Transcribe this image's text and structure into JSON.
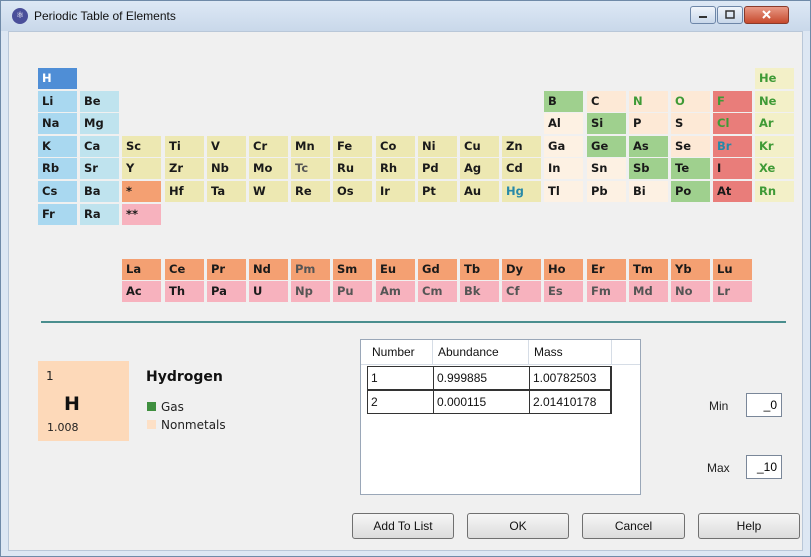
{
  "window": {
    "title": "Periodic Table of Elements",
    "app_icon": "atom-app-icon"
  },
  "elements": [
    {
      "sym": "H",
      "cat": "h",
      "state": "white",
      "r": 0,
      "c": 0
    },
    {
      "sym": "He",
      "cat": "noble",
      "state": "gas",
      "r": 0,
      "c": 17
    },
    {
      "sym": "Li",
      "cat": "alk",
      "state": "solid",
      "r": 1,
      "c": 0
    },
    {
      "sym": "Be",
      "cat": "alke",
      "state": "solid",
      "r": 1,
      "c": 1
    },
    {
      "sym": "B",
      "cat": "metl",
      "state": "solid",
      "r": 1,
      "c": 12
    },
    {
      "sym": "C",
      "cat": "nonm",
      "state": "solid",
      "r": 1,
      "c": 13
    },
    {
      "sym": "N",
      "cat": "nonm",
      "state": "gas",
      "r": 1,
      "c": 14
    },
    {
      "sym": "O",
      "cat": "nonm",
      "state": "gas",
      "r": 1,
      "c": 15
    },
    {
      "sym": "F",
      "cat": "hal",
      "state": "gas",
      "r": 1,
      "c": 16
    },
    {
      "sym": "Ne",
      "cat": "noble",
      "state": "gas",
      "r": 1,
      "c": 17
    },
    {
      "sym": "Na",
      "cat": "alk",
      "state": "solid",
      "r": 2,
      "c": 0
    },
    {
      "sym": "Mg",
      "cat": "alke",
      "state": "solid",
      "r": 2,
      "c": 1
    },
    {
      "sym": "Al",
      "cat": "post",
      "state": "solid",
      "r": 2,
      "c": 12
    },
    {
      "sym": "Si",
      "cat": "metl",
      "state": "solid",
      "r": 2,
      "c": 13
    },
    {
      "sym": "P",
      "cat": "nonm",
      "state": "solid",
      "r": 2,
      "c": 14
    },
    {
      "sym": "S",
      "cat": "nonm",
      "state": "solid",
      "r": 2,
      "c": 15
    },
    {
      "sym": "Cl",
      "cat": "hal",
      "state": "gas",
      "r": 2,
      "c": 16
    },
    {
      "sym": "Ar",
      "cat": "noble",
      "state": "gas",
      "r": 2,
      "c": 17
    },
    {
      "sym": "K",
      "cat": "alk",
      "state": "solid",
      "r": 3,
      "c": 0
    },
    {
      "sym": "Ca",
      "cat": "alke",
      "state": "solid",
      "r": 3,
      "c": 1
    },
    {
      "sym": "Sc",
      "cat": "trans",
      "state": "solid",
      "r": 3,
      "c": 2
    },
    {
      "sym": "Ti",
      "cat": "trans",
      "state": "solid",
      "r": 3,
      "c": 3
    },
    {
      "sym": "V",
      "cat": "trans",
      "state": "solid",
      "r": 3,
      "c": 4
    },
    {
      "sym": "Cr",
      "cat": "trans",
      "state": "solid",
      "r": 3,
      "c": 5
    },
    {
      "sym": "Mn",
      "cat": "trans",
      "state": "solid",
      "r": 3,
      "c": 6
    },
    {
      "sym": "Fe",
      "cat": "trans",
      "state": "solid",
      "r": 3,
      "c": 7
    },
    {
      "sym": "Co",
      "cat": "trans",
      "state": "solid",
      "r": 3,
      "c": 8
    },
    {
      "sym": "Ni",
      "cat": "trans",
      "state": "solid",
      "r": 3,
      "c": 9
    },
    {
      "sym": "Cu",
      "cat": "trans",
      "state": "solid",
      "r": 3,
      "c": 10
    },
    {
      "sym": "Zn",
      "cat": "trans",
      "state": "solid",
      "r": 3,
      "c": 11
    },
    {
      "sym": "Ga",
      "cat": "post",
      "state": "solid",
      "r": 3,
      "c": 12
    },
    {
      "sym": "Ge",
      "cat": "metl",
      "state": "solid",
      "r": 3,
      "c": 13
    },
    {
      "sym": "As",
      "cat": "metl",
      "state": "solid",
      "r": 3,
      "c": 14
    },
    {
      "sym": "Se",
      "cat": "nonm",
      "state": "solid",
      "r": 3,
      "c": 15
    },
    {
      "sym": "Br",
      "cat": "hal",
      "state": "liq",
      "r": 3,
      "c": 16
    },
    {
      "sym": "Kr",
      "cat": "noble",
      "state": "gas",
      "r": 3,
      "c": 17
    },
    {
      "sym": "Rb",
      "cat": "alk",
      "state": "solid",
      "r": 4,
      "c": 0
    },
    {
      "sym": "Sr",
      "cat": "alke",
      "state": "solid",
      "r": 4,
      "c": 1
    },
    {
      "sym": "Y",
      "cat": "trans",
      "state": "solid",
      "r": 4,
      "c": 2
    },
    {
      "sym": "Zr",
      "cat": "trans",
      "state": "solid",
      "r": 4,
      "c": 3
    },
    {
      "sym": "Nb",
      "cat": "trans",
      "state": "solid",
      "r": 4,
      "c": 4
    },
    {
      "sym": "Mo",
      "cat": "trans",
      "state": "solid",
      "r": 4,
      "c": 5
    },
    {
      "sym": "Tc",
      "cat": "trans",
      "state": "unk",
      "r": 4,
      "c": 6
    },
    {
      "sym": "Ru",
      "cat": "trans",
      "state": "solid",
      "r": 4,
      "c": 7
    },
    {
      "sym": "Rh",
      "cat": "trans",
      "state": "solid",
      "r": 4,
      "c": 8
    },
    {
      "sym": "Pd",
      "cat": "trans",
      "state": "solid",
      "r": 4,
      "c": 9
    },
    {
      "sym": "Ag",
      "cat": "trans",
      "state": "solid",
      "r": 4,
      "c": 10
    },
    {
      "sym": "Cd",
      "cat": "trans",
      "state": "solid",
      "r": 4,
      "c": 11
    },
    {
      "sym": "In",
      "cat": "post",
      "state": "solid",
      "r": 4,
      "c": 12
    },
    {
      "sym": "Sn",
      "cat": "post",
      "state": "solid",
      "r": 4,
      "c": 13
    },
    {
      "sym": "Sb",
      "cat": "metl",
      "state": "solid",
      "r": 4,
      "c": 14
    },
    {
      "sym": "Te",
      "cat": "metl",
      "state": "solid",
      "r": 4,
      "c": 15
    },
    {
      "sym": "I",
      "cat": "hal",
      "state": "solid",
      "r": 4,
      "c": 16
    },
    {
      "sym": "Xe",
      "cat": "noble",
      "state": "gas",
      "r": 4,
      "c": 17
    },
    {
      "sym": "Cs",
      "cat": "alk",
      "state": "solid",
      "r": 5,
      "c": 0
    },
    {
      "sym": "Ba",
      "cat": "alke",
      "state": "solid",
      "r": 5,
      "c": 1
    },
    {
      "sym": "*",
      "cat": "lan",
      "state": "solid",
      "r": 5,
      "c": 2
    },
    {
      "sym": "Hf",
      "cat": "trans",
      "state": "solid",
      "r": 5,
      "c": 3
    },
    {
      "sym": "Ta",
      "cat": "trans",
      "state": "solid",
      "r": 5,
      "c": 4
    },
    {
      "sym": "W",
      "cat": "trans",
      "state": "solid",
      "r": 5,
      "c": 5
    },
    {
      "sym": "Re",
      "cat": "trans",
      "state": "solid",
      "r": 5,
      "c": 6
    },
    {
      "sym": "Os",
      "cat": "trans",
      "state": "solid",
      "r": 5,
      "c": 7
    },
    {
      "sym": "Ir",
      "cat": "trans",
      "state": "solid",
      "r": 5,
      "c": 8
    },
    {
      "sym": "Pt",
      "cat": "trans",
      "state": "solid",
      "r": 5,
      "c": 9
    },
    {
      "sym": "Au",
      "cat": "trans",
      "state": "solid",
      "r": 5,
      "c": 10
    },
    {
      "sym": "Hg",
      "cat": "trans",
      "state": "liq",
      "r": 5,
      "c": 11
    },
    {
      "sym": "Tl",
      "cat": "post",
      "state": "solid",
      "r": 5,
      "c": 12
    },
    {
      "sym": "Pb",
      "cat": "post",
      "state": "solid",
      "r": 5,
      "c": 13
    },
    {
      "sym": "Bi",
      "cat": "post",
      "state": "solid",
      "r": 5,
      "c": 14
    },
    {
      "sym": "Po",
      "cat": "metl",
      "state": "solid",
      "r": 5,
      "c": 15
    },
    {
      "sym": "At",
      "cat": "hal",
      "state": "solid",
      "r": 5,
      "c": 16
    },
    {
      "sym": "Rn",
      "cat": "noble",
      "state": "gas",
      "r": 5,
      "c": 17
    },
    {
      "sym": "Fr",
      "cat": "alk",
      "state": "solid",
      "r": 6,
      "c": 0
    },
    {
      "sym": "Ra",
      "cat": "alke",
      "state": "solid",
      "r": 6,
      "c": 1
    },
    {
      "sym": "**",
      "cat": "act",
      "state": "solid",
      "r": 6,
      "c": 2
    },
    {
      "sym": "La",
      "cat": "lan",
      "state": "solid",
      "r": 8,
      "c": 2
    },
    {
      "sym": "Ce",
      "cat": "lan",
      "state": "solid",
      "r": 8,
      "c": 3
    },
    {
      "sym": "Pr",
      "cat": "lan",
      "state": "solid",
      "r": 8,
      "c": 4
    },
    {
      "sym": "Nd",
      "cat": "lan",
      "state": "solid",
      "r": 8,
      "c": 5
    },
    {
      "sym": "Pm",
      "cat": "lan",
      "state": "unk",
      "r": 8,
      "c": 6
    },
    {
      "sym": "Sm",
      "cat": "lan",
      "state": "solid",
      "r": 8,
      "c": 7
    },
    {
      "sym": "Eu",
      "cat": "lan",
      "state": "solid",
      "r": 8,
      "c": 8
    },
    {
      "sym": "Gd",
      "cat": "lan",
      "state": "solid",
      "r": 8,
      "c": 9
    },
    {
      "sym": "Tb",
      "cat": "lan",
      "state": "solid",
      "r": 8,
      "c": 10
    },
    {
      "sym": "Dy",
      "cat": "lan",
      "state": "solid",
      "r": 8,
      "c": 11
    },
    {
      "sym": "Ho",
      "cat": "lan",
      "state": "solid",
      "r": 8,
      "c": 12
    },
    {
      "sym": "Er",
      "cat": "lan",
      "state": "solid",
      "r": 8,
      "c": 13
    },
    {
      "sym": "Tm",
      "cat": "lan",
      "state": "solid",
      "r": 8,
      "c": 14
    },
    {
      "sym": "Yb",
      "cat": "lan",
      "state": "solid",
      "r": 8,
      "c": 15
    },
    {
      "sym": "Lu",
      "cat": "lan",
      "state": "solid",
      "r": 8,
      "c": 16
    },
    {
      "sym": "Ac",
      "cat": "act",
      "state": "solid",
      "r": 9,
      "c": 2
    },
    {
      "sym": "Th",
      "cat": "act",
      "state": "solid",
      "r": 9,
      "c": 3
    },
    {
      "sym": "Pa",
      "cat": "act",
      "state": "solid",
      "r": 9,
      "c": 4
    },
    {
      "sym": "U",
      "cat": "act",
      "state": "solid",
      "r": 9,
      "c": 5
    },
    {
      "sym": "Np",
      "cat": "act",
      "state": "unk",
      "r": 9,
      "c": 6
    },
    {
      "sym": "Pu",
      "cat": "act",
      "state": "unk",
      "r": 9,
      "c": 7
    },
    {
      "sym": "Am",
      "cat": "act",
      "state": "unk",
      "r": 9,
      "c": 8
    },
    {
      "sym": "Cm",
      "cat": "act",
      "state": "unk",
      "r": 9,
      "c": 9
    },
    {
      "sym": "Bk",
      "cat": "act",
      "state": "unk",
      "r": 9,
      "c": 10
    },
    {
      "sym": "Cf",
      "cat": "act",
      "state": "unk",
      "r": 9,
      "c": 11
    },
    {
      "sym": "Es",
      "cat": "act",
      "state": "unk",
      "r": 9,
      "c": 12
    },
    {
      "sym": "Fm",
      "cat": "act",
      "state": "unk",
      "r": 9,
      "c": 13
    },
    {
      "sym": "Md",
      "cat": "act",
      "state": "unk",
      "r": 9,
      "c": 14
    },
    {
      "sym": "No",
      "cat": "act",
      "state": "unk",
      "r": 9,
      "c": 15
    },
    {
      "sym": "Lr",
      "cat": "act",
      "state": "unk",
      "r": 9,
      "c": 16
    }
  ],
  "selected": {
    "number": "1",
    "symbol": "H",
    "mass": "1.008",
    "name": "Hydrogen",
    "state_label": "Gas",
    "state_color": "#3f8f3f",
    "category_label": "Nonmetals",
    "category_color": "#fde0c6"
  },
  "isotopes": {
    "headers": [
      "Number",
      "Abundance",
      "Mass"
    ],
    "rows": [
      [
        "1",
        "0.999885",
        "1.00782503"
      ],
      [
        "2",
        "0.000115",
        "2.01410178"
      ]
    ]
  },
  "range": {
    "min_label": "Min",
    "min_value": "_0",
    "max_label": "Max",
    "max_value": "_10"
  },
  "buttons": {
    "add": "Add To List",
    "ok": "OK",
    "cancel": "Cancel",
    "help": "Help"
  }
}
